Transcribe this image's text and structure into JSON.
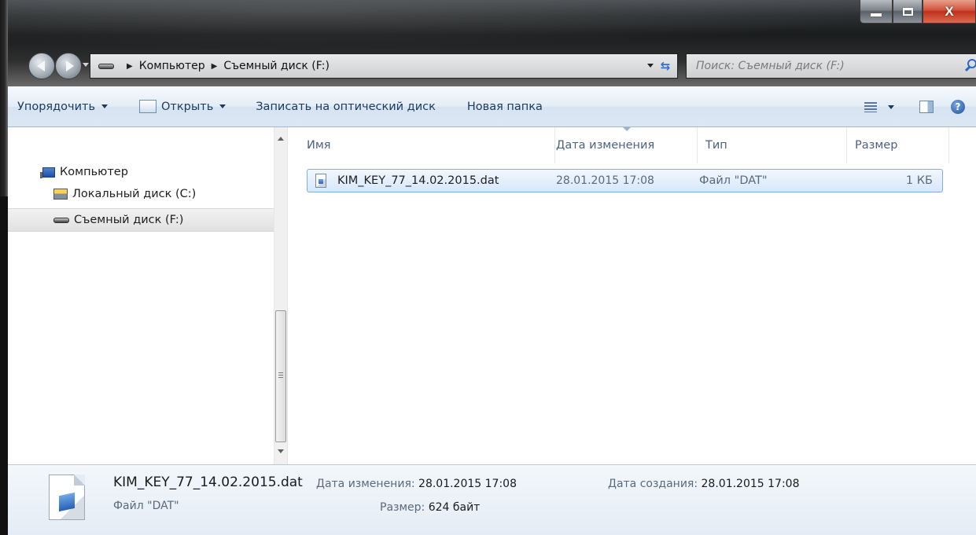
{
  "address": {
    "crumbs": [
      "Компьютер",
      "Съемный диск (F:)"
    ],
    "search_placeholder": "Поиск: Съемный диск (F:)"
  },
  "window_buttons": {
    "close_glyph": "X"
  },
  "toolbar": {
    "organize": "Упорядочить",
    "open": "Открыть",
    "burn": "Записать на оптический диск",
    "new_folder": "Новая папка"
  },
  "nav": {
    "computer": "Компьютер",
    "local_disk": "Локальный диск (C:)",
    "removable_disk": "Съемный диск (F:)",
    "selected": "removable_disk"
  },
  "columns": {
    "name": "Имя",
    "date": "Дата изменения",
    "type": "Тип",
    "size": "Размер"
  },
  "files": [
    {
      "name": "KIM_KEY_77_14.02.2015.dat",
      "date": "28.01.2015 17:08",
      "type": "Файл \"DAT\"",
      "size": "1 КБ",
      "selected": true
    }
  ],
  "details": {
    "name": "KIM_KEY_77_14.02.2015.dat",
    "type": "Файл \"DAT\"",
    "modified_label": "Дата изменения:",
    "modified_value": "28.01.2015 17:08",
    "created_label": "Дата создания:",
    "created_value": "28.01.2015 17:08",
    "size_label": "Размер:",
    "size_value": "624 байт"
  },
  "icons": {
    "back": "back-arrow-icon",
    "forward": "forward-arrow-icon",
    "refresh": "refresh-icon",
    "search": "search-icon",
    "help": "help-icon",
    "help_glyph": "?"
  }
}
